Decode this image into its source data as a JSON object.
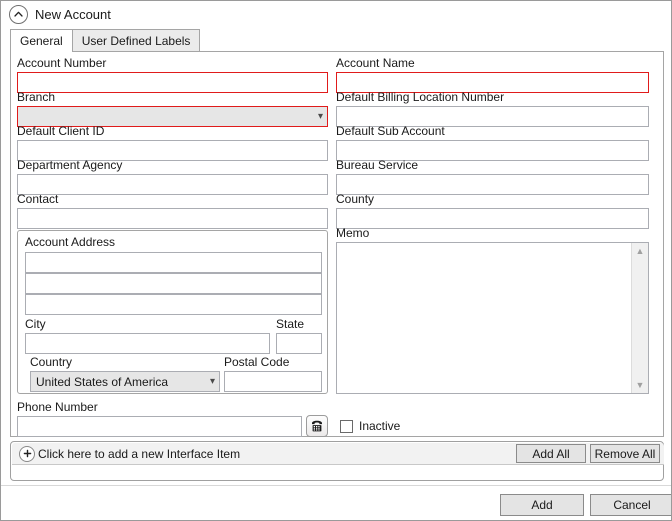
{
  "window": {
    "title": "New Account",
    "collapse_icon": "chevron-up-circle-icon"
  },
  "tabs": [
    {
      "label": "General",
      "active": true
    },
    {
      "label": "User Defined Labels",
      "active": false
    }
  ],
  "form": {
    "left_column": [
      {
        "label": "Account Number",
        "type": "text",
        "value": "",
        "required": true
      },
      {
        "label": "Branch",
        "type": "combo",
        "value": "",
        "required": true
      },
      {
        "label": "Default Client ID",
        "type": "text",
        "value": "",
        "required": false
      },
      {
        "label": "Department Agency",
        "type": "text",
        "value": "",
        "required": false
      },
      {
        "label": "Contact",
        "type": "text",
        "value": "",
        "required": false
      }
    ],
    "right_column": [
      {
        "label": "Account Name",
        "type": "text",
        "value": "",
        "required": true
      },
      {
        "label": "Default Billing Location Number",
        "type": "text",
        "value": "",
        "required": false
      },
      {
        "label": "Default Sub Account",
        "type": "text",
        "value": "",
        "required": false
      },
      {
        "label": "Bureau Service",
        "type": "text",
        "value": "",
        "required": false
      },
      {
        "label": "County",
        "type": "text",
        "value": "",
        "required": false
      }
    ],
    "address_group": {
      "title": "Account Address",
      "line1": "",
      "line2": "",
      "line3": "",
      "city_label": "City",
      "city_value": "",
      "state_label": "State",
      "state_value": "",
      "country_label": "Country",
      "country_value": "United States of America",
      "postal_label": "Postal Code",
      "postal_value": ""
    },
    "memo": {
      "label": "Memo",
      "value": "",
      "scroll_up_icon": "chevron-up-icon",
      "scroll_down_icon": "chevron-down-icon"
    },
    "phone": {
      "label": "Phone Number",
      "value": "",
      "dialer_icon": "telephone-icon"
    },
    "inactive": {
      "label": "Inactive",
      "checked": false
    }
  },
  "interface_list": {
    "add_row_icon": "plus-circle-icon",
    "add_row_text": "Click here to add a new Interface Item",
    "add_all_label": "Add All",
    "remove_all_label": "Remove All"
  },
  "footer": {
    "add_label": "Add",
    "cancel_label": "Cancel"
  },
  "colors": {
    "required_border": "#e01b1b",
    "field_border": "#abadb3",
    "panel_border": "#a5a5a5",
    "button_face": "#e4e4e4",
    "combo_face": "#e6e6e6"
  }
}
